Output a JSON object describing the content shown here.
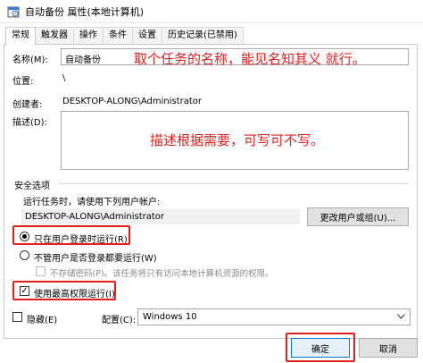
{
  "window": {
    "title": "自动备份 属性(本地计算机)",
    "icon": "task-scheduler-icon"
  },
  "tabs": [
    {
      "label": "常规",
      "active": true
    },
    {
      "label": "触发器",
      "active": false
    },
    {
      "label": "操作",
      "active": false
    },
    {
      "label": "条件",
      "active": false
    },
    {
      "label": "设置",
      "active": false
    },
    {
      "label": "历史记录(已禁用)",
      "active": false
    }
  ],
  "general": {
    "name_label": "名称(M):",
    "name_value": "自动备份",
    "location_label": "位置:",
    "location_value": "\\",
    "author_label": "创建者:",
    "author_value": "DESKTOP-ALONG\\Administrator",
    "description_label": "描述(D):",
    "description_value": ""
  },
  "annotations": {
    "name_note": "取个任务的名称，能见名知其义 就行。",
    "description_note": "描述根据需要，可写可不写。",
    "color": "#e02020"
  },
  "security": {
    "section_title": "安全选项",
    "run_as_label": "运行任务时，请使用下列用户帐户:",
    "run_as_user": "DESKTOP-ALONG\\Administrator",
    "change_user_button": "更改用户或组(U)...",
    "radio_logged_on": "只在用户登录时运行(R)",
    "radio_logged_on_checked": true,
    "radio_whether": "不管用户是否登录都要运行(W)",
    "radio_whether_checked": false,
    "no_store_password": "不存储密码(P)。该任务将只有访问本地计算机资源的权限。",
    "no_store_password_checked": false,
    "highest_privileges": "使用最高权限运行(I)",
    "highest_privileges_checked": true
  },
  "footer": {
    "hidden_label": "隐藏(E)",
    "hidden_checked": false,
    "configure_label": "配置(C):",
    "configure_value": "Windows 10",
    "ok_button": "确定",
    "cancel_button": "取消"
  }
}
